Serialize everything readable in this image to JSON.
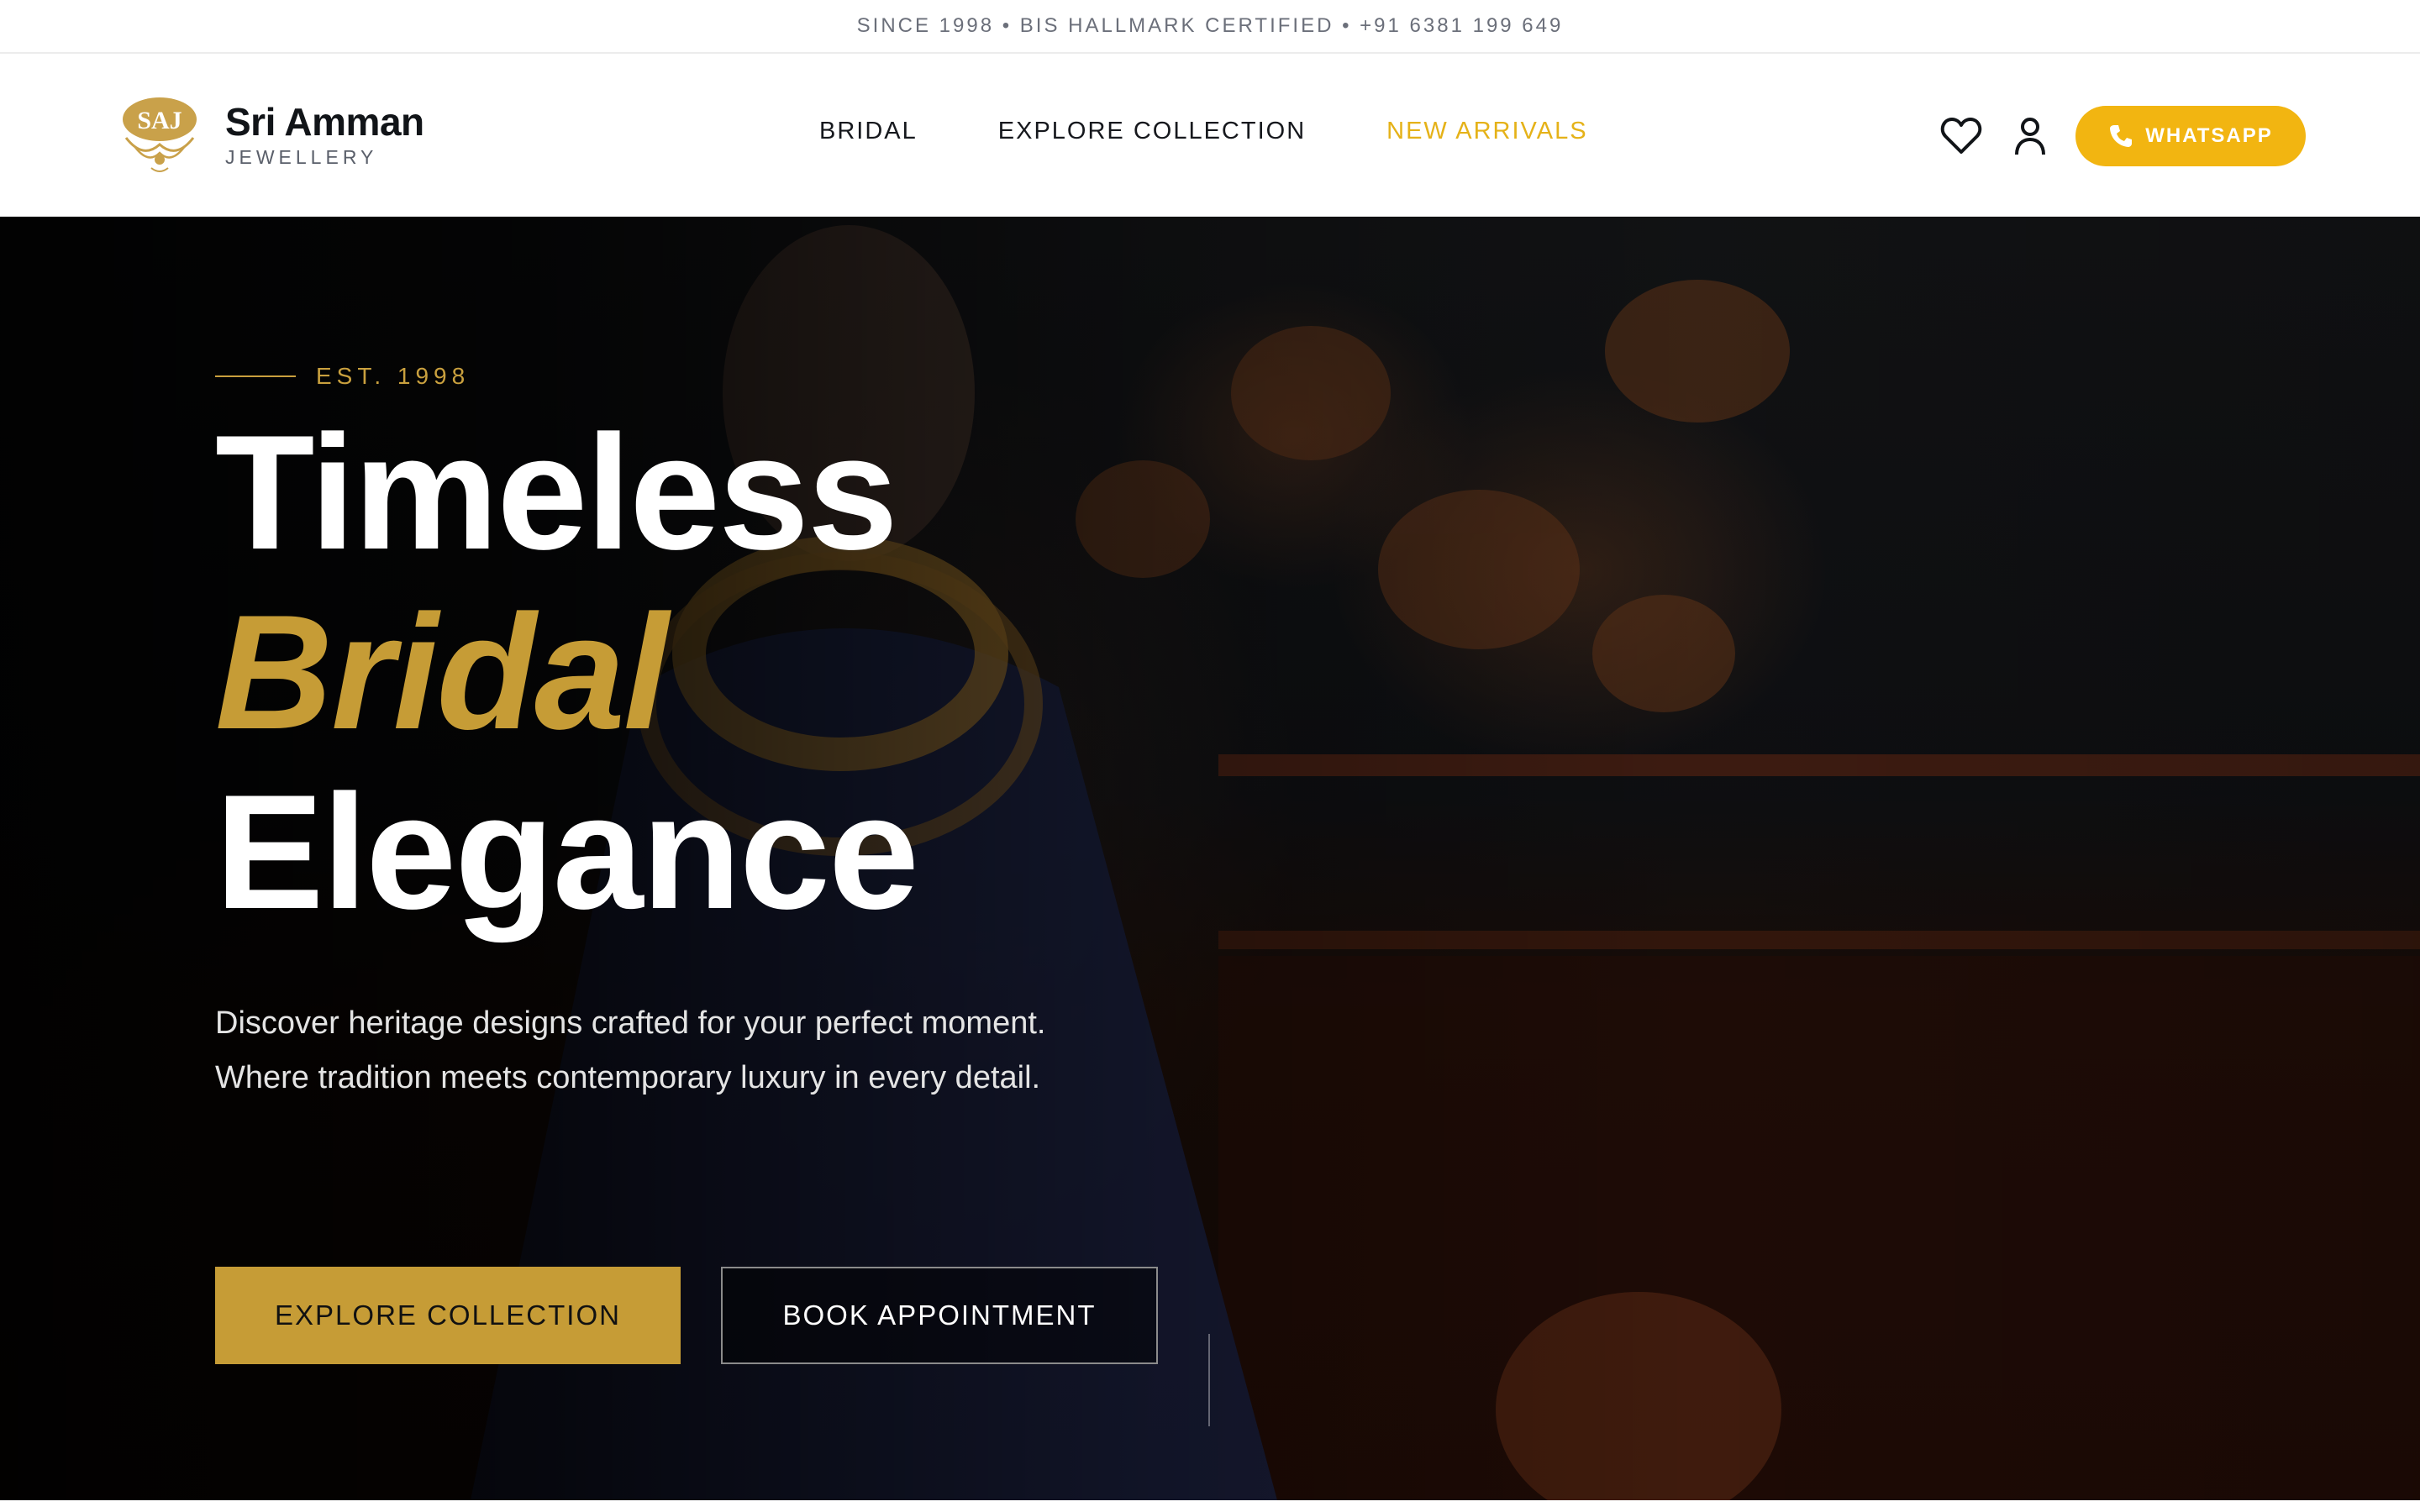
{
  "topbar": {
    "text": "SINCE 1998 • BIS HALLMARK CERTIFIED • +91 6381 199 649"
  },
  "brand": {
    "emblem_text": "SAJ",
    "name": "Sri Amman",
    "subtitle": "JEWELLERY"
  },
  "nav": {
    "items": [
      {
        "label": "BRIDAL",
        "active": false
      },
      {
        "label": "EXPLORE COLLECTION",
        "active": false
      },
      {
        "label": "NEW ARRIVALS",
        "active": true
      }
    ]
  },
  "actions": {
    "wishlist_icon": "heart-icon",
    "account_icon": "user-icon",
    "whatsapp_label": "WHATSAPP",
    "whatsapp_icon": "phone-icon"
  },
  "hero": {
    "eyebrow": "EST. 1998",
    "headline": [
      "Timeless",
      "Bridal",
      "Elegance"
    ],
    "subcopy": "Discover heritage designs crafted for your perfect moment. Where tradition meets contemporary luxury in every detail.",
    "primary_cta": "EXPLORE COLLECTION",
    "secondary_cta": "BOOK APPOINTMENT"
  },
  "colors": {
    "gold": "#c69c36",
    "whatsapp_yellow": "#f2b511",
    "active_nav": "#e5b218",
    "dark": "#111418"
  }
}
